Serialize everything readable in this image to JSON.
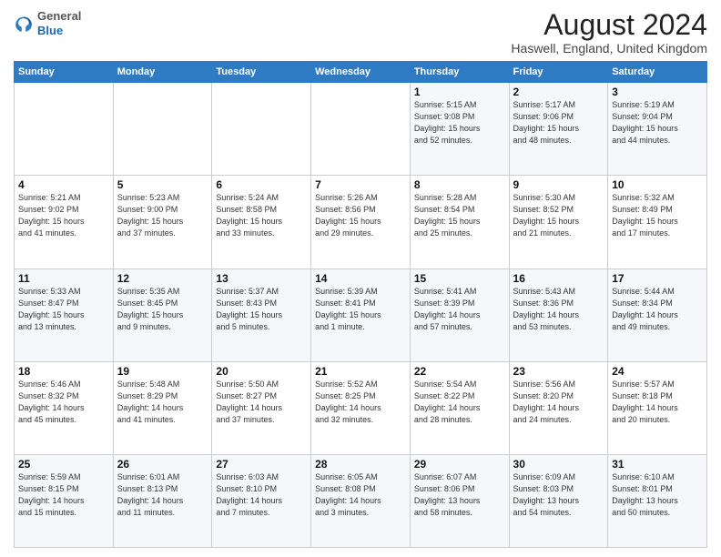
{
  "logo": {
    "general": "General",
    "blue": "Blue"
  },
  "header": {
    "month": "August 2024",
    "location": "Haswell, England, United Kingdom"
  },
  "weekdays": [
    "Sunday",
    "Monday",
    "Tuesday",
    "Wednesday",
    "Thursday",
    "Friday",
    "Saturday"
  ],
  "weeks": [
    [
      {
        "day": "",
        "info": ""
      },
      {
        "day": "",
        "info": ""
      },
      {
        "day": "",
        "info": ""
      },
      {
        "day": "",
        "info": ""
      },
      {
        "day": "1",
        "info": "Sunrise: 5:15 AM\nSunset: 9:08 PM\nDaylight: 15 hours\nand 52 minutes."
      },
      {
        "day": "2",
        "info": "Sunrise: 5:17 AM\nSunset: 9:06 PM\nDaylight: 15 hours\nand 48 minutes."
      },
      {
        "day": "3",
        "info": "Sunrise: 5:19 AM\nSunset: 9:04 PM\nDaylight: 15 hours\nand 44 minutes."
      }
    ],
    [
      {
        "day": "4",
        "info": "Sunrise: 5:21 AM\nSunset: 9:02 PM\nDaylight: 15 hours\nand 41 minutes."
      },
      {
        "day": "5",
        "info": "Sunrise: 5:23 AM\nSunset: 9:00 PM\nDaylight: 15 hours\nand 37 minutes."
      },
      {
        "day": "6",
        "info": "Sunrise: 5:24 AM\nSunset: 8:58 PM\nDaylight: 15 hours\nand 33 minutes."
      },
      {
        "day": "7",
        "info": "Sunrise: 5:26 AM\nSunset: 8:56 PM\nDaylight: 15 hours\nand 29 minutes."
      },
      {
        "day": "8",
        "info": "Sunrise: 5:28 AM\nSunset: 8:54 PM\nDaylight: 15 hours\nand 25 minutes."
      },
      {
        "day": "9",
        "info": "Sunrise: 5:30 AM\nSunset: 8:52 PM\nDaylight: 15 hours\nand 21 minutes."
      },
      {
        "day": "10",
        "info": "Sunrise: 5:32 AM\nSunset: 8:49 PM\nDaylight: 15 hours\nand 17 minutes."
      }
    ],
    [
      {
        "day": "11",
        "info": "Sunrise: 5:33 AM\nSunset: 8:47 PM\nDaylight: 15 hours\nand 13 minutes."
      },
      {
        "day": "12",
        "info": "Sunrise: 5:35 AM\nSunset: 8:45 PM\nDaylight: 15 hours\nand 9 minutes."
      },
      {
        "day": "13",
        "info": "Sunrise: 5:37 AM\nSunset: 8:43 PM\nDaylight: 15 hours\nand 5 minutes."
      },
      {
        "day": "14",
        "info": "Sunrise: 5:39 AM\nSunset: 8:41 PM\nDaylight: 15 hours\nand 1 minute."
      },
      {
        "day": "15",
        "info": "Sunrise: 5:41 AM\nSunset: 8:39 PM\nDaylight: 14 hours\nand 57 minutes."
      },
      {
        "day": "16",
        "info": "Sunrise: 5:43 AM\nSunset: 8:36 PM\nDaylight: 14 hours\nand 53 minutes."
      },
      {
        "day": "17",
        "info": "Sunrise: 5:44 AM\nSunset: 8:34 PM\nDaylight: 14 hours\nand 49 minutes."
      }
    ],
    [
      {
        "day": "18",
        "info": "Sunrise: 5:46 AM\nSunset: 8:32 PM\nDaylight: 14 hours\nand 45 minutes."
      },
      {
        "day": "19",
        "info": "Sunrise: 5:48 AM\nSunset: 8:29 PM\nDaylight: 14 hours\nand 41 minutes."
      },
      {
        "day": "20",
        "info": "Sunrise: 5:50 AM\nSunset: 8:27 PM\nDaylight: 14 hours\nand 37 minutes."
      },
      {
        "day": "21",
        "info": "Sunrise: 5:52 AM\nSunset: 8:25 PM\nDaylight: 14 hours\nand 32 minutes."
      },
      {
        "day": "22",
        "info": "Sunrise: 5:54 AM\nSunset: 8:22 PM\nDaylight: 14 hours\nand 28 minutes."
      },
      {
        "day": "23",
        "info": "Sunrise: 5:56 AM\nSunset: 8:20 PM\nDaylight: 14 hours\nand 24 minutes."
      },
      {
        "day": "24",
        "info": "Sunrise: 5:57 AM\nSunset: 8:18 PM\nDaylight: 14 hours\nand 20 minutes."
      }
    ],
    [
      {
        "day": "25",
        "info": "Sunrise: 5:59 AM\nSunset: 8:15 PM\nDaylight: 14 hours\nand 15 minutes."
      },
      {
        "day": "26",
        "info": "Sunrise: 6:01 AM\nSunset: 8:13 PM\nDaylight: 14 hours\nand 11 minutes."
      },
      {
        "day": "27",
        "info": "Sunrise: 6:03 AM\nSunset: 8:10 PM\nDaylight: 14 hours\nand 7 minutes."
      },
      {
        "day": "28",
        "info": "Sunrise: 6:05 AM\nSunset: 8:08 PM\nDaylight: 14 hours\nand 3 minutes."
      },
      {
        "day": "29",
        "info": "Sunrise: 6:07 AM\nSunset: 8:06 PM\nDaylight: 13 hours\nand 58 minutes."
      },
      {
        "day": "30",
        "info": "Sunrise: 6:09 AM\nSunset: 8:03 PM\nDaylight: 13 hours\nand 54 minutes."
      },
      {
        "day": "31",
        "info": "Sunrise: 6:10 AM\nSunset: 8:01 PM\nDaylight: 13 hours\nand 50 minutes."
      }
    ]
  ]
}
